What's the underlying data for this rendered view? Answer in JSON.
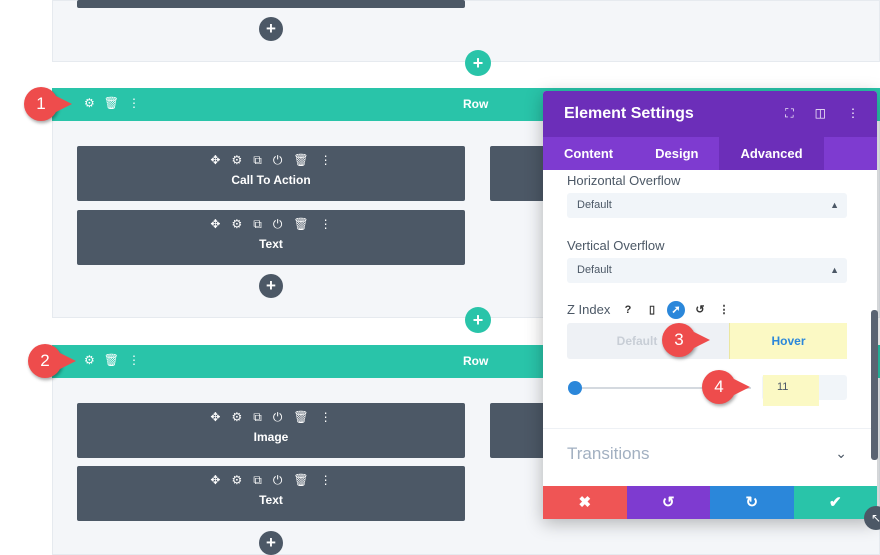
{
  "rows": [
    {
      "label": "Row",
      "marker": "1"
    },
    {
      "label": "Row",
      "marker": "2"
    }
  ],
  "modules": {
    "row1_col1": [
      {
        "label": "Call To Action"
      },
      {
        "label": "Text"
      }
    ],
    "row2_col1": [
      {
        "label": "Image"
      },
      {
        "label": "Text"
      }
    ]
  },
  "icons": {
    "move": "✥",
    "gear": "⚙",
    "duplicate": "⧉",
    "power": "⏻",
    "trash": "🗑",
    "more": "⋮",
    "add": "+",
    "help": "?",
    "phone": "▯",
    "cursor": "➚",
    "undo": "↺",
    "chevron": "⌄",
    "close": "✖",
    "redo": "↻",
    "check": "✔",
    "expand": "⛶",
    "split": "◫",
    "resize": "↖"
  },
  "panel": {
    "title": "Element Settings",
    "tabs": [
      "Content",
      "Design",
      "Advanced"
    ],
    "active_tab": "Advanced",
    "fields": {
      "horizontal_overflow": {
        "label": "Horizontal Overflow",
        "value": "Default"
      },
      "vertical_overflow": {
        "label": "Vertical Overflow",
        "value": "Default"
      },
      "z_index": {
        "label": "Z Index",
        "toggle_default": "Default",
        "toggle_hover": "Hover",
        "value": "11"
      }
    },
    "transitions_label": "Transitions"
  },
  "markers": {
    "m3": "3",
    "m4": "4"
  },
  "colors": {
    "row_bar": "#29c4a9",
    "module_bg": "#4c5866",
    "panel_header": "#6c2eb9",
    "panel_tabs": "#7e3bd0",
    "marker": "#ee4c4c",
    "footer_cancel": "#ef5555",
    "footer_undo": "#7e3bd0",
    "footer_redo": "#2b87da",
    "footer_save": "#29c4a9",
    "highlight": "#fbf9c4"
  }
}
